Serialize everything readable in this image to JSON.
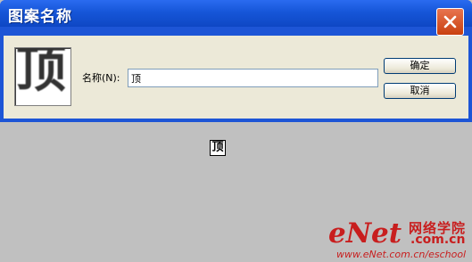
{
  "dialog": {
    "title": "图案名称",
    "preview_glyph": "顶",
    "name_label": "名称(N):",
    "name_value": "顶",
    "ok_label": "确定",
    "cancel_label": "取消"
  },
  "canvas": {
    "pattern_text": "顶"
  },
  "watermark": {
    "brand": "eNet",
    "chinese": "网络学院",
    "domain": ".com.cn",
    "url": "www.eNet.com.cn/eschool"
  },
  "colors": {
    "titlebar": "#1656d8",
    "close_button": "#d8542a",
    "watermark": "#c81e1e",
    "background": "#c0c0c0"
  }
}
